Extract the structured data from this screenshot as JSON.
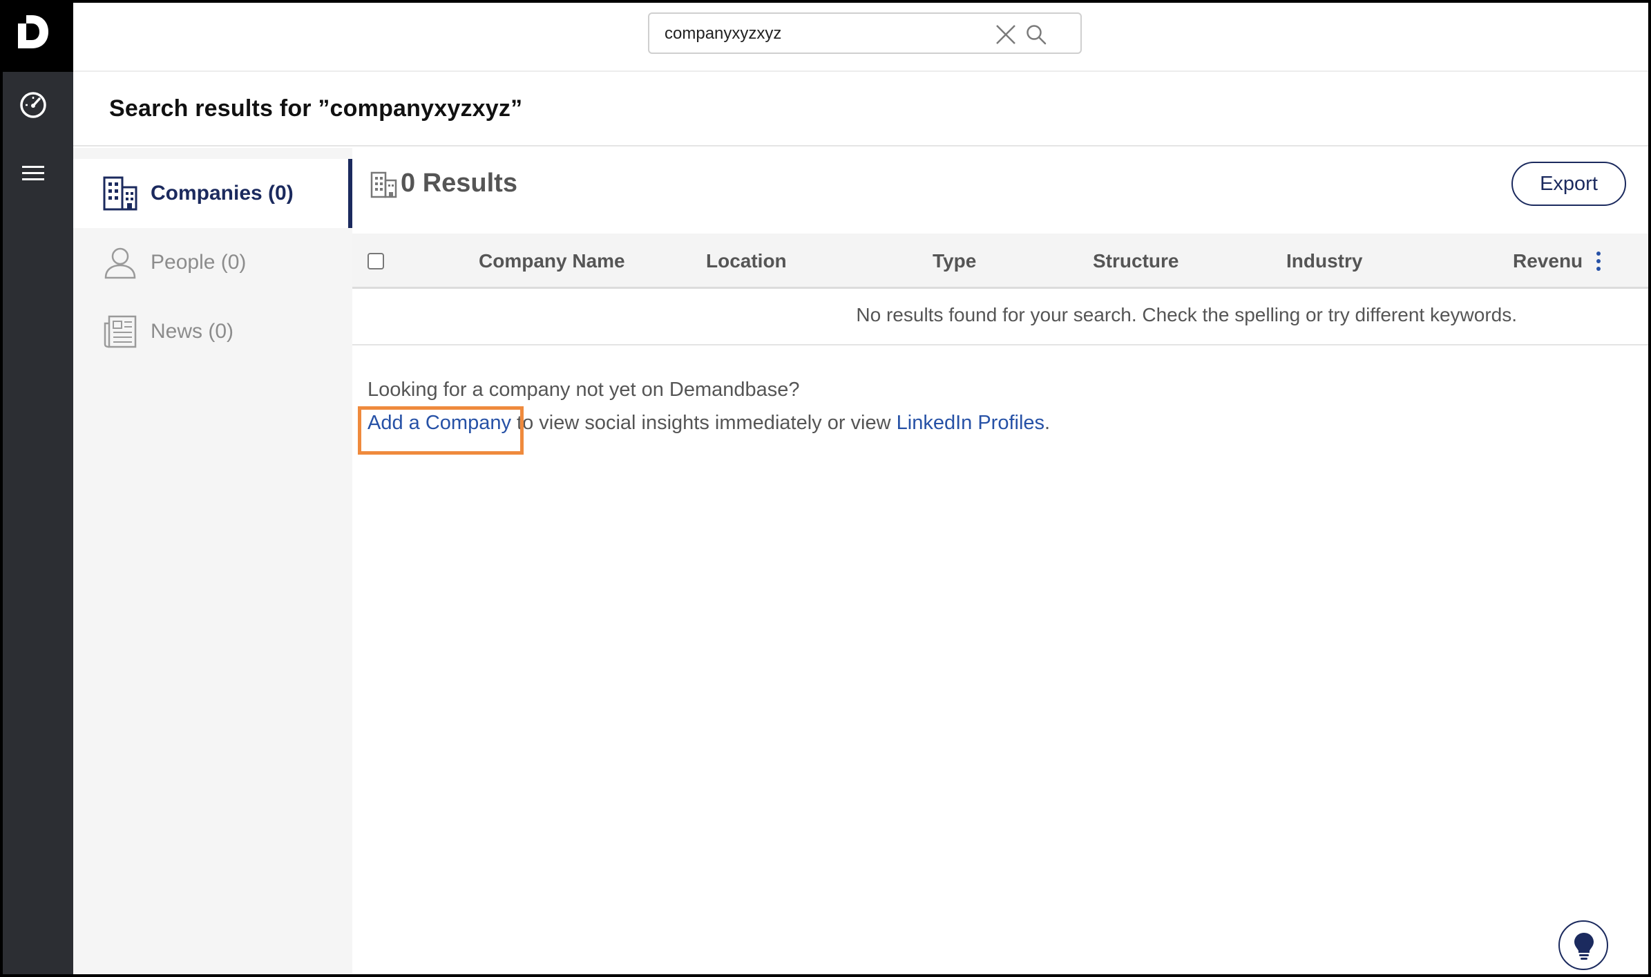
{
  "search": {
    "value": "companyxyzxyz",
    "placeholder": ""
  },
  "page": {
    "title": "Search results for ”companyxyzxyz”"
  },
  "categories": [
    {
      "label": "Companies (0)",
      "icon": "buildings-icon",
      "active": true
    },
    {
      "label": "People (0)",
      "icon": "person-icon",
      "active": false
    },
    {
      "label": "News (0)",
      "icon": "newspaper-icon",
      "active": false
    }
  ],
  "results": {
    "title": "0 Results",
    "export_label": "Export"
  },
  "table": {
    "columns": [
      "Company Name",
      "Location",
      "Type",
      "Structure",
      "Industry",
      "Revenu"
    ],
    "empty_message": "No results found for your search. Check the spelling or try different keywords."
  },
  "lookup": {
    "line1": "Looking for a company not yet on Demandbase?",
    "add_company_link": "Add a Company",
    "middle_text": " to view social insights immediately or view ",
    "linkedin_link": "LinkedIn Profiles",
    "end_text": "."
  },
  "colors": {
    "rail": "#2c2e33",
    "accent": "#1b2a5e",
    "link": "#2651a6",
    "highlight": "#ef8a3d"
  }
}
